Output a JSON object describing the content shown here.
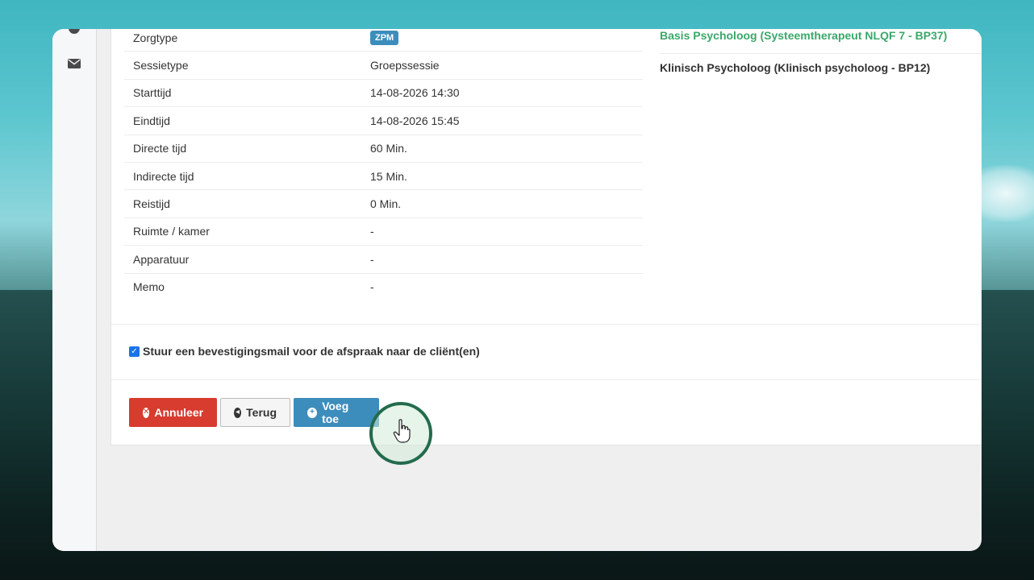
{
  "details": {
    "rows": [
      {
        "label": "Zorgtype",
        "value": "ZPM",
        "is_badge": true
      },
      {
        "label": "Sessietype",
        "value": "Groepssessie"
      },
      {
        "label": "Starttijd",
        "value": "14-08-2026 14:30"
      },
      {
        "label": "Eindtijd",
        "value": "14-08-2026 15:45"
      },
      {
        "label": "Directe tijd",
        "value": "60 Min."
      },
      {
        "label": "Indirecte tijd",
        "value": "15 Min."
      },
      {
        "label": "Reistijd",
        "value": "0 Min."
      },
      {
        "label": "Ruimte / kamer",
        "value": "-"
      },
      {
        "label": "Apparatuur",
        "value": "-"
      },
      {
        "label": "Memo",
        "value": "-"
      }
    ]
  },
  "providers": {
    "active": "Basis Psycholoog (Systeemtherapeut NLQF 7 - BP37)",
    "other": "Klinisch Psycholoog (Klinisch psycholoog - BP12)"
  },
  "confirm": {
    "label": "Stuur een bevestigingsmail voor de afspraak naar de cliënt(en)",
    "checked": true
  },
  "buttons": {
    "cancel": "Annuleer",
    "back": "Terug",
    "add": "Voeg toe"
  },
  "colors": {
    "primary": "#3c8dbc",
    "danger": "#d73c2f",
    "success_text": "#3aa86a",
    "cursor_ring": "#236b4c"
  },
  "icons": {
    "sidebar": [
      "envelope-icon"
    ],
    "cancel": "times-circle-icon",
    "back": "arrow-circle-left-icon",
    "add": "plus-circle-icon"
  }
}
